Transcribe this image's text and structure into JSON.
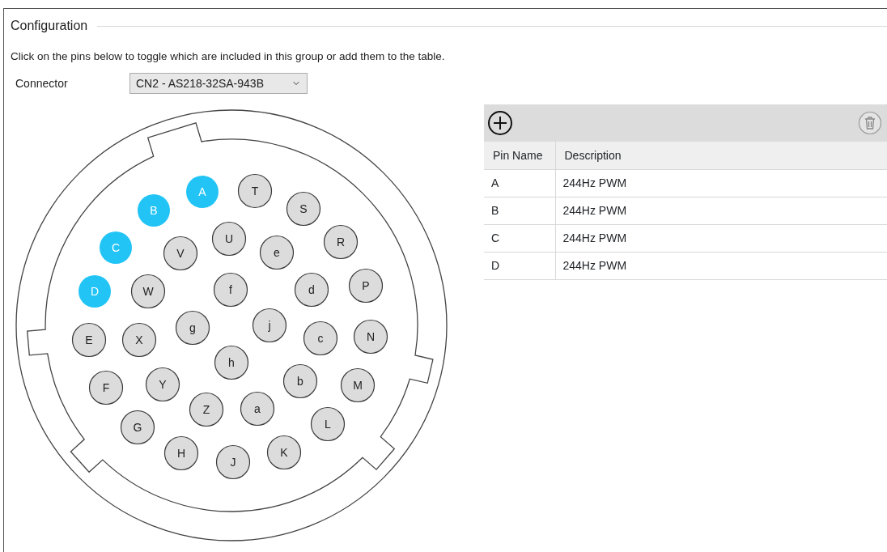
{
  "section_title": "Configuration",
  "instruction": "Click on the pins below to toggle which are included in this group or add them to the table.",
  "connector": {
    "label": "Connector",
    "value": "CN2 - AS218-32SA-943B"
  },
  "pins": [
    {
      "label": "A",
      "selected": true
    },
    {
      "label": "T",
      "selected": false
    },
    {
      "label": "B",
      "selected": true
    },
    {
      "label": "S",
      "selected": false
    },
    {
      "label": "U",
      "selected": false
    },
    {
      "label": "e",
      "selected": false
    },
    {
      "label": "R",
      "selected": false
    },
    {
      "label": "C",
      "selected": true
    },
    {
      "label": "V",
      "selected": false
    },
    {
      "label": "D",
      "selected": true
    },
    {
      "label": "W",
      "selected": false
    },
    {
      "label": "f",
      "selected": false
    },
    {
      "label": "d",
      "selected": false
    },
    {
      "label": "P",
      "selected": false
    },
    {
      "label": "E",
      "selected": false
    },
    {
      "label": "X",
      "selected": false
    },
    {
      "label": "g",
      "selected": false
    },
    {
      "label": "j",
      "selected": false
    },
    {
      "label": "c",
      "selected": false
    },
    {
      "label": "N",
      "selected": false
    },
    {
      "label": "h",
      "selected": false
    },
    {
      "label": "F",
      "selected": false
    },
    {
      "label": "Y",
      "selected": false
    },
    {
      "label": "b",
      "selected": false
    },
    {
      "label": "M",
      "selected": false
    },
    {
      "label": "Z",
      "selected": false
    },
    {
      "label": "a",
      "selected": false
    },
    {
      "label": "G",
      "selected": false
    },
    {
      "label": "L",
      "selected": false
    },
    {
      "label": "H",
      "selected": false
    },
    {
      "label": "J",
      "selected": false
    },
    {
      "label": "K",
      "selected": false
    }
  ],
  "table": {
    "columns": [
      "Pin Name",
      "Description"
    ],
    "rows": [
      [
        "A",
        "244Hz PWM"
      ],
      [
        "B",
        "244Hz PWM"
      ],
      [
        "C",
        "244Hz PWM"
      ],
      [
        "D",
        "244Hz PWM"
      ]
    ]
  }
}
